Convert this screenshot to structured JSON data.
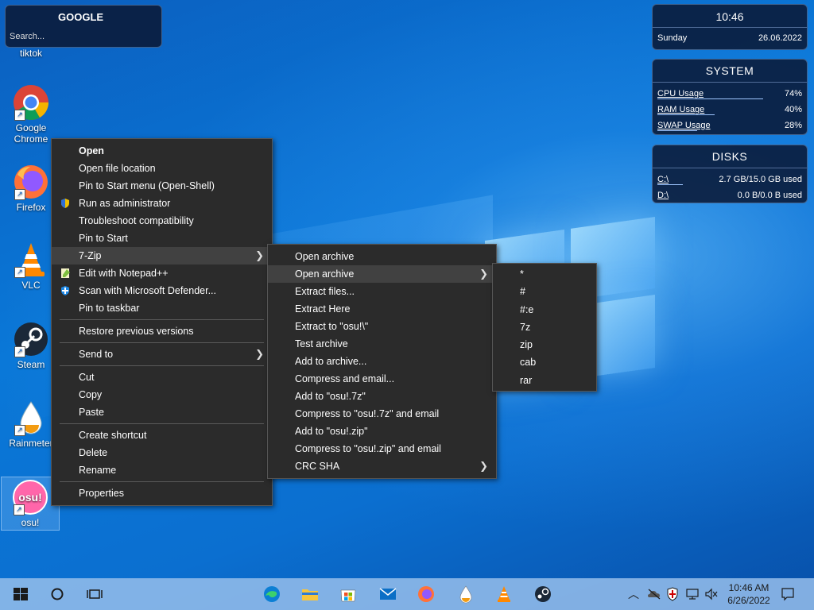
{
  "desktop_icons": [
    {
      "label": "tiktok"
    },
    {
      "label": "Google Chrome"
    },
    {
      "label": "Firefox"
    },
    {
      "label": "VLC"
    },
    {
      "label": "Steam"
    },
    {
      "label": "Rainmeter"
    },
    {
      "label": "osu!"
    }
  ],
  "google_widget": {
    "title": "GOOGLE",
    "placeholder": "Search..."
  },
  "clock_widget": {
    "time": "10:46",
    "day": "Sunday",
    "date": "26.06.2022"
  },
  "system_widget": {
    "title": "SYSTEM",
    "rows": [
      {
        "label": "CPU Usage",
        "value": "74%",
        "level": 0.74
      },
      {
        "label": "RAM Usage",
        "value": "40%",
        "level": 0.4
      },
      {
        "label": "SWAP Usage",
        "value": "28%",
        "level": 0.28
      }
    ]
  },
  "disks_widget": {
    "title": "DISKS",
    "rows": [
      {
        "label": "C:\\",
        "value": "2.7 GB/15.0 GB used",
        "level": 0.18
      },
      {
        "label": "D:\\",
        "value": "0.0 B/0.0 B used",
        "level": 0.0
      }
    ]
  },
  "context_menu": {
    "items": [
      "Open",
      "Open file location",
      "Pin to Start menu (Open-Shell)",
      "Run as administrator",
      "Troubleshoot compatibility",
      "Pin to Start",
      "7-Zip",
      "Edit with Notepad++",
      "Scan with Microsoft Defender...",
      "Pin to taskbar",
      "Restore previous versions",
      "Send to",
      "Cut",
      "Copy",
      "Paste",
      "Create shortcut",
      "Delete",
      "Rename",
      "Properties"
    ]
  },
  "zip_menu": {
    "items": [
      "Open archive",
      "Open archive",
      "Extract files...",
      "Extract Here",
      "Extract to \"osu!\\\"",
      "Test archive",
      "Add to archive...",
      "Compress and email...",
      "Add to \"osu!.7z\"",
      "Compress to \"osu!.7z\" and email",
      "Add to \"osu!.zip\"",
      "Compress to \"osu!.zip\" and email",
      "CRC SHA"
    ]
  },
  "open_archive_menu": {
    "items": [
      "*",
      "#",
      "#:e",
      "7z",
      "zip",
      "cab",
      "rar"
    ]
  },
  "taskbar": {
    "time": "10:46 AM",
    "date": "6/26/2022",
    "apps": [
      "start-icon",
      "search-icon",
      "task-view-icon",
      "edge-icon",
      "file-explorer-icon",
      "microsoft-store-icon",
      "mail-icon",
      "firefox-icon",
      "rainmeter-icon",
      "vlc-icon",
      "steam-icon"
    ]
  }
}
